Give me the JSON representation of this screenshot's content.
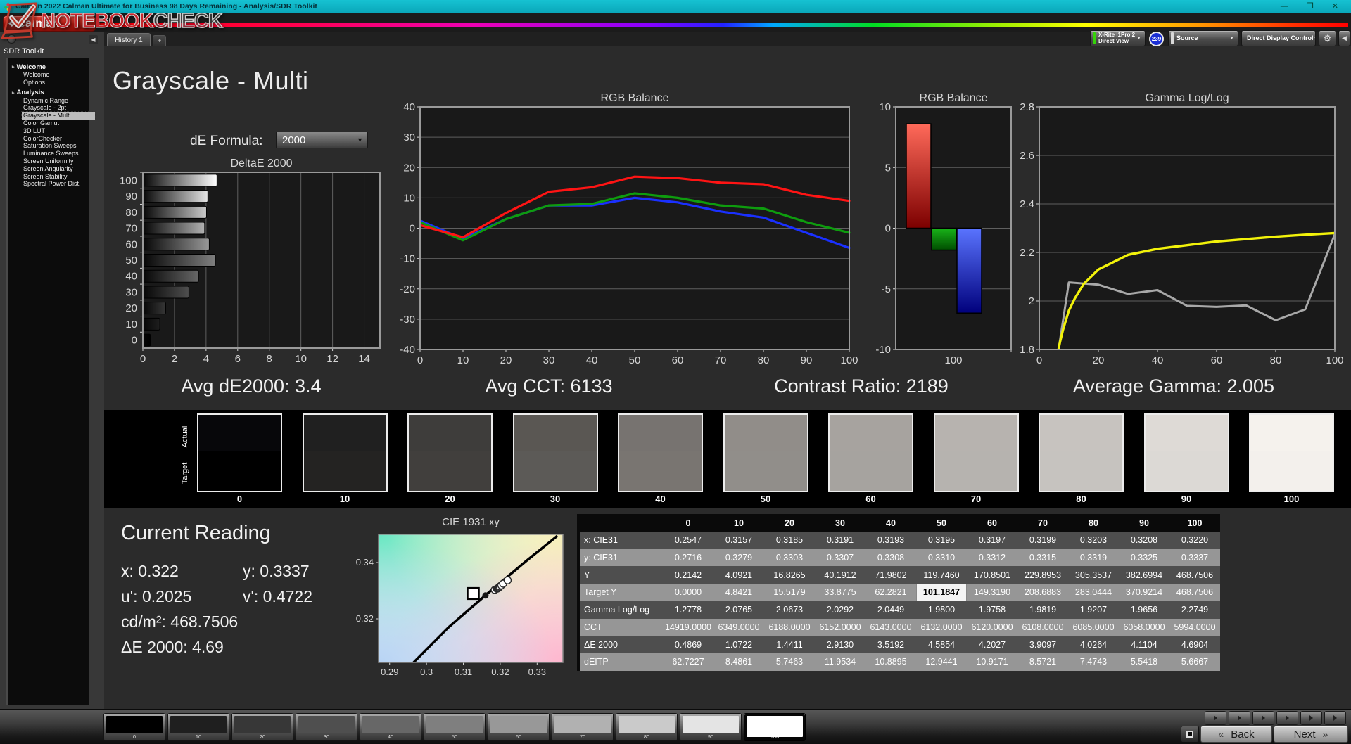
{
  "window": {
    "title": "Calman 2022 Calman Ultimate for Business 98 Days Remaining  - Analysis/SDR Toolkit"
  },
  "icons": {
    "expander": "▸",
    "dropdown": "▼",
    "collapse_left": "◀",
    "gear": "⚙",
    "minimize": "—",
    "maximize": "❐",
    "close": "✕",
    "back_chevron": "«",
    "next_chevron": "»",
    "plus": "+",
    "logo_glyph": "❖"
  },
  "brand": {
    "logo_text": "calman"
  },
  "tabs": {
    "history": "History 1"
  },
  "top_controls": {
    "meter_line1": "X-Rite i1Pro 2",
    "meter_line2": "Direct View",
    "meter_badge": "239",
    "meter_accent": "#35d30a",
    "source_label": "Source",
    "source_accent": "#d8d8d8",
    "display_label": "Direct Display Control",
    "display_accent": "#ece400"
  },
  "sidebar": {
    "title": "SDR Toolkit",
    "selected": "Grayscale - Multi",
    "groups": [
      {
        "label": "Welcome",
        "items": [
          "Welcome",
          "Options"
        ]
      },
      {
        "label": "Analysis",
        "items": [
          "Dynamic Range",
          "Grayscale - 2pt",
          "Grayscale - Multi",
          "Color Gamut",
          "3D LUT",
          "ColorChecker",
          "Saturation Sweeps",
          "Luminance Sweeps",
          "Screen Uniformity",
          "Screen Angularity",
          "Screen Stability",
          "Spectral Power Dist."
        ]
      }
    ]
  },
  "page": {
    "title": "Grayscale - Multi",
    "de_formula_label": "dE Formula:",
    "de_formula_value": "2000"
  },
  "stats": [
    "Avg dE2000: 3.4",
    "Avg CCT: 6133",
    "Contrast Ratio: 2189",
    "Average Gamma: 2.005"
  ],
  "chart_data": [
    {
      "type": "bar",
      "orientation": "horizontal",
      "title": "DeltaE 2000",
      "categories": [
        0,
        10,
        20,
        30,
        40,
        50,
        60,
        70,
        80,
        90,
        100
      ],
      "values": [
        0.4869,
        1.0722,
        1.4411,
        2.913,
        3.5192,
        4.5854,
        4.2027,
        3.9097,
        4.0264,
        4.1104,
        4.6904
      ],
      "xlim": [
        0,
        15
      ],
      "xticks": [
        0,
        2,
        4,
        6,
        8,
        10,
        12,
        14
      ],
      "display_order": "100 at top, 0 at bottom"
    },
    {
      "type": "line",
      "title": "RGB Balance",
      "x": [
        0,
        10,
        20,
        30,
        40,
        50,
        60,
        70,
        80,
        90,
        100
      ],
      "series": [
        {
          "name": "Red",
          "color": "#ff1414",
          "values": [
            1,
            -3,
            5,
            12,
            13.5,
            17,
            16.5,
            15,
            14.5,
            11,
            9
          ]
        },
        {
          "name": "Green",
          "color": "#0e9c0e",
          "values": [
            2,
            -4,
            3,
            7.5,
            8,
            11.5,
            10,
            7.5,
            6.5,
            2,
            -1.5
          ]
        },
        {
          "name": "Blue",
          "color": "#1a30ff",
          "values": [
            2.5,
            -3.5,
            3,
            7.5,
            7.5,
            10,
            8.5,
            5.5,
            3.5,
            -1.5,
            -6.5
          ]
        }
      ],
      "ylim": [
        -40,
        40
      ],
      "yticks": [
        -40,
        -30,
        -20,
        -10,
        0,
        10,
        20,
        30,
        40
      ],
      "xticks": [
        0,
        10,
        20,
        30,
        40,
        50,
        60,
        70,
        80,
        90,
        100
      ]
    },
    {
      "type": "bar",
      "title": "RGB Balance",
      "categories": [
        "100"
      ],
      "series": [
        {
          "name": "Red",
          "color": "#e01010",
          "value": 8.6
        },
        {
          "name": "Green",
          "color": "#0c8c0c",
          "value": -1.8
        },
        {
          "name": "Blue",
          "color": "#1414e6",
          "value": -7.0
        }
      ],
      "ylim": [
        -10,
        10
      ],
      "yticks": [
        10,
        5,
        0,
        -5,
        -10
      ]
    },
    {
      "type": "line",
      "title": "Gamma Log/Log",
      "ylim": [
        1.8,
        2.8
      ],
      "yticks": [
        1.8,
        2,
        2.2,
        2.4,
        2.6,
        2.8
      ],
      "xticks": [
        0,
        20,
        40,
        60,
        80,
        100
      ],
      "series": [
        {
          "name": "Target Gamma",
          "color": "#f2f20a",
          "x": [
            3,
            4,
            5,
            6,
            7,
            8,
            10,
            12,
            15,
            20,
            25,
            30,
            40,
            50,
            60,
            70,
            80,
            90,
            100
          ],
          "values": [
            1.5,
            1.6,
            1.7,
            1.77,
            1.83,
            1.88,
            1.96,
            2.01,
            2.07,
            2.13,
            2.16,
            2.19,
            2.215,
            2.23,
            2.245,
            2.255,
            2.265,
            2.273,
            2.28
          ]
        },
        {
          "name": "Measured Gamma",
          "color": "#a8a8a8",
          "x": [
            0,
            10,
            20,
            30,
            40,
            50,
            60,
            70,
            80,
            90,
            100
          ],
          "values": [
            1.2778,
            2.0765,
            2.0673,
            2.0292,
            2.0449,
            1.98,
            1.9758,
            1.9819,
            1.9207,
            1.9656,
            2.2749
          ]
        }
      ]
    },
    {
      "type": "scatter",
      "title": "CIE 1931 xy",
      "xlim": [
        0.287,
        0.337
      ],
      "ylim": [
        0.3045,
        0.35
      ],
      "xticks": [
        0.29,
        0.3,
        0.31,
        0.32,
        0.33
      ],
      "yticks": [
        0.32,
        0.34
      ],
      "locus": [
        [
          0.2965,
          0.3045
        ],
        [
          0.306,
          0.317
        ],
        [
          0.317,
          0.3295
        ],
        [
          0.327,
          0.3405
        ],
        [
          0.3355,
          0.3495
        ]
      ],
      "target": [
        0.3127,
        0.329
      ],
      "reference_dot": [
        0.316,
        0.3283
      ],
      "points": [
        [
          0.3185,
          0.3303
        ],
        [
          0.3191,
          0.3307
        ],
        [
          0.3193,
          0.3308
        ],
        [
          0.3195,
          0.331
        ],
        [
          0.3197,
          0.3312
        ],
        [
          0.3199,
          0.3315
        ],
        [
          0.3203,
          0.3319
        ],
        [
          0.3208,
          0.3325
        ],
        [
          0.322,
          0.3337
        ]
      ]
    }
  ],
  "gray_swatches": {
    "row_label_top": "Actual",
    "row_label_bottom": "Target",
    "levels": [
      "0",
      "10",
      "20",
      "30",
      "40",
      "50",
      "60",
      "70",
      "80",
      "90",
      "100"
    ],
    "actual_colors": [
      "#07070a",
      "#202020",
      "#3e3d3b",
      "#5a5753",
      "#777370",
      "#918d89",
      "#a7a39f",
      "#b7b3af",
      "#c7c3bf",
      "#dedad6",
      "#f5f2ed"
    ],
    "target_colors": [
      "#000000",
      "#242322",
      "#413f3d",
      "#5c5a57",
      "#797571",
      "#918e8a",
      "#a6a39f",
      "#b6b3af",
      "#c6c3bf",
      "#dcd9d5",
      "#f3f0ec"
    ]
  },
  "current_reading": {
    "title": "Current Reading",
    "pairs": [
      {
        "label": "x:",
        "value": "0.322"
      },
      {
        "label": "y:",
        "value": "0.3337"
      },
      {
        "label": "u':",
        "value": "0.2025"
      },
      {
        "label": "v':",
        "value": "0.4722"
      },
      {
        "label": "cd/m²:",
        "value": "468.7506"
      },
      {
        "label": "ΔE 2000:",
        "value": "4.69"
      }
    ]
  },
  "table": {
    "columns": [
      "0",
      "10",
      "20",
      "30",
      "40",
      "50",
      "60",
      "70",
      "80",
      "90",
      "100"
    ],
    "rows": [
      {
        "label": "x: CIE31",
        "values": [
          "0.2547",
          "0.3157",
          "0.3185",
          "0.3191",
          "0.3193",
          "0.3195",
          "0.3197",
          "0.3199",
          "0.3203",
          "0.3208",
          "0.3220"
        ]
      },
      {
        "label": "y: CIE31",
        "values": [
          "0.2716",
          "0.3279",
          "0.3303",
          "0.3307",
          "0.3308",
          "0.3310",
          "0.3312",
          "0.3315",
          "0.3319",
          "0.3325",
          "0.3337"
        ]
      },
      {
        "label": "Y",
        "values": [
          "0.2142",
          "4.0921",
          "16.8265",
          "40.1912",
          "71.9802",
          "119.7460",
          "170.8501",
          "229.8953",
          "305.3537",
          "382.6994",
          "468.7506"
        ]
      },
      {
        "label": "Target Y",
        "values": [
          "0.0000",
          "4.8421",
          "15.5179",
          "33.8775",
          "62.2821",
          "101.1847",
          "149.3190",
          "208.6883",
          "283.0444",
          "370.9214",
          "468.7506"
        ]
      },
      {
        "label": "Gamma Log/Log",
        "values": [
          "1.2778",
          "2.0765",
          "2.0673",
          "2.0292",
          "2.0449",
          "1.9800",
          "1.9758",
          "1.9819",
          "1.9207",
          "1.9656",
          "2.2749"
        ]
      },
      {
        "label": "CCT",
        "values": [
          "14919.0000",
          "6349.0000",
          "6188.0000",
          "6152.0000",
          "6143.0000",
          "6132.0000",
          "6120.0000",
          "6108.0000",
          "6085.0000",
          "6058.0000",
          "5994.0000"
        ]
      },
      {
        "label": "ΔE 2000",
        "values": [
          "0.4869",
          "1.0722",
          "1.4411",
          "2.9130",
          "3.5192",
          "4.5854",
          "4.2027",
          "3.9097",
          "4.0264",
          "4.1104",
          "4.6904"
        ]
      },
      {
        "label": "dEITP",
        "values": [
          "62.7227",
          "8.4861",
          "5.7463",
          "11.9534",
          "10.8895",
          "12.9441",
          "10.9171",
          "8.5721",
          "7.4743",
          "5.5418",
          "5.6667"
        ]
      }
    ],
    "highlight": {
      "row_label": "Target Y",
      "col_index": 5
    }
  },
  "bottom": {
    "patterns": {
      "labels": [
        "0",
        "10",
        "20",
        "30",
        "40",
        "50",
        "60",
        "70",
        "80",
        "90",
        "100"
      ],
      "colors": [
        "#000000",
        "#1f1f1f",
        "#373737",
        "#4f4f4f",
        "#676767",
        "#7f7f7f",
        "#989898",
        "#b1b1b1",
        "#cacaca",
        "#e4e4e4",
        "#ffffff"
      ],
      "selected_index": 10
    },
    "back_label": "Back",
    "next_label": "Next"
  },
  "watermark": {
    "part1": "NOTEBOOK",
    "part2": "CHECK"
  }
}
